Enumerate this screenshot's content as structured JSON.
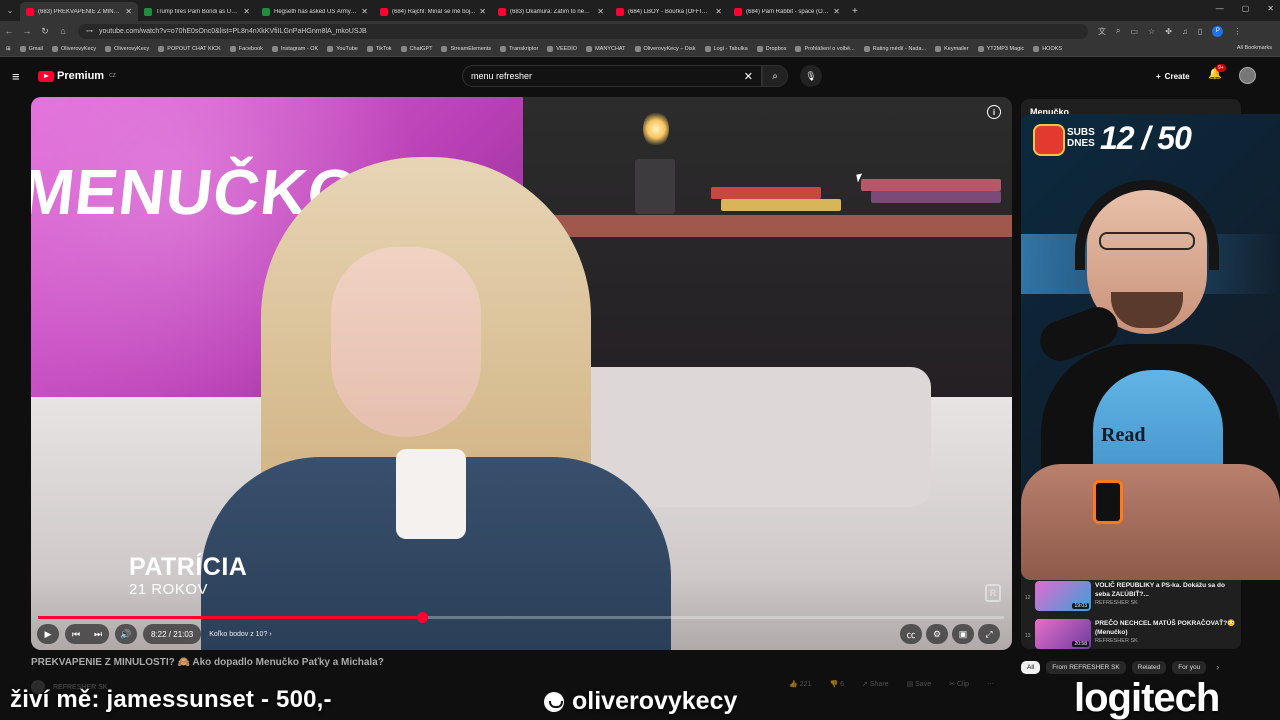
{
  "browser": {
    "tabs": [
      {
        "title": "(683) PREKVAPENIE Z MINULOSTI",
        "favicon": "youtube-icon",
        "active": true
      },
      {
        "title": "Trump fires Pam Bondi as US attorney",
        "favicon": "sheet-icon",
        "active": false
      },
      {
        "title": "Hegseth has asked US Army chief",
        "favicon": "sheet-icon",
        "active": false
      },
      {
        "title": "(684) Rajchl: Mináľ se mě boj...",
        "favicon": "youtube-icon",
        "active": false
      },
      {
        "title": "(683) Okamura: Zatím to nedělá",
        "favicon": "youtube-icon",
        "active": false
      },
      {
        "title": "(684) LBOY - Bouřka (OFFICIAL",
        "favicon": "youtube-icon",
        "active": false
      },
      {
        "title": "(684) Pam Rabbit - space (Offic",
        "favicon": "youtube-icon",
        "active": false
      }
    ],
    "url": "youtube.com/watch?v=o70hE0sOnc0&list=PL8n4nXkKVfiILGnPaHGnm8lA_mkoUSJB",
    "profile_letter": "P",
    "bookmarks": [
      "Gmail",
      "OliverovyKecy",
      "OliverovyKecy",
      "POPOUT CHAT KICK",
      "Facebook",
      "Instagram - OK",
      "YouTube",
      "TikTok",
      "ChatGPT",
      "StreamElements",
      "Transkriptor",
      "VEEDIO",
      "MANYCHAT",
      "OliverovyKecy – Disk",
      "Logi - Tabulka",
      "Dropbox",
      "Prohlášení o volbě...",
      "Rating médií - Nada...",
      "Keymailer",
      "YT2MP3 Magic",
      "HOOKS"
    ],
    "all_bookmarks": "All Bookmarks"
  },
  "youtube": {
    "logo_text": "Premium",
    "logo_region": "CZ",
    "search_value": "menu refresher",
    "create_label": "Create",
    "notifications_badge": "9+"
  },
  "player": {
    "sign_text": "MENUČKO",
    "name_overlay": "PATRÍCIA",
    "age_overlay": "21 ROKOV",
    "watermark_letter": "R",
    "time_display": "8:22 / 21:03",
    "chapter_label": "Koľko bodov z 10?",
    "progress_fraction": 0.397,
    "accent_color": "#ff0033"
  },
  "video": {
    "title": "PREKVAPENIE Z MINULOSTI? 🙈 Ako dopadlo Menučko Paťky a Michala?",
    "channel": "REFRESHER SK",
    "likes": "221",
    "dislike": "6",
    "share_label": "Share",
    "save_label": "Save",
    "clip_label": "Clip"
  },
  "playlist": {
    "title": "Menučko",
    "items": [
      {
        "index": "12",
        "title": "VOLIČ REPUBLIKY a PS-ka. Dokážu sa do seba ZAĽÚBIŤ?...",
        "channel": "REFRESHER SK",
        "duration": "19:03"
      },
      {
        "index": "13",
        "title": "PREČO NECHCEL MATÚŠ POKRAČOVAŤ?😳 (Menučko)",
        "channel": "REFRESHER SK",
        "duration": "20:58"
      }
    ]
  },
  "filters": [
    "All",
    "From REFRESHER SK",
    "Related",
    "For you"
  ],
  "stream_overlay": {
    "subs_label_line1": "SUBS",
    "subs_label_line2": "DNES",
    "subs_count": "12 / 50",
    "donation_text": "živí mě: jamessunset - 500,-",
    "handle": "oliverovykecy",
    "sponsor": "logitech",
    "tee_text": "Read"
  }
}
